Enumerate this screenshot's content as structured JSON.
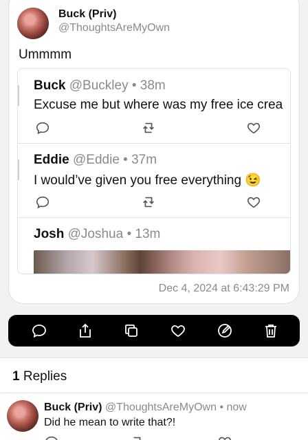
{
  "post": {
    "author_name": "Buck (Priv)",
    "author_handle": "@ThoughtsAreMyOwn",
    "text": "Ummmm",
    "timestamp": "Dec 4, 2024 at 6:43:29 PM"
  },
  "thread": [
    {
      "name": "Buck",
      "meta": "@Buckley • 38m",
      "text": "Excuse me but where was my free ice crea"
    },
    {
      "name": "Eddie",
      "meta": "@Eddie • 37m",
      "text": "I would’ve given you free everything 😉"
    },
    {
      "name": "Josh",
      "meta": "@Joshua • 13m"
    }
  ],
  "toolbar": {
    "icons": [
      "reply-icon",
      "share-icon",
      "copy-icon",
      "like-icon",
      "edit-icon",
      "trash-icon"
    ],
    "color": "#ffffff"
  },
  "replies": {
    "count": "1",
    "label": " Replies",
    "items": [
      {
        "name": "Buck (Priv)",
        "meta": "@ThoughtsAreMyOwn • now",
        "text": "Did he mean to write that?!"
      }
    ]
  },
  "colors": {
    "secondary_text": "#8a8a8e",
    "background": "#f2f2f4",
    "toolbar_bg": "#000000"
  }
}
